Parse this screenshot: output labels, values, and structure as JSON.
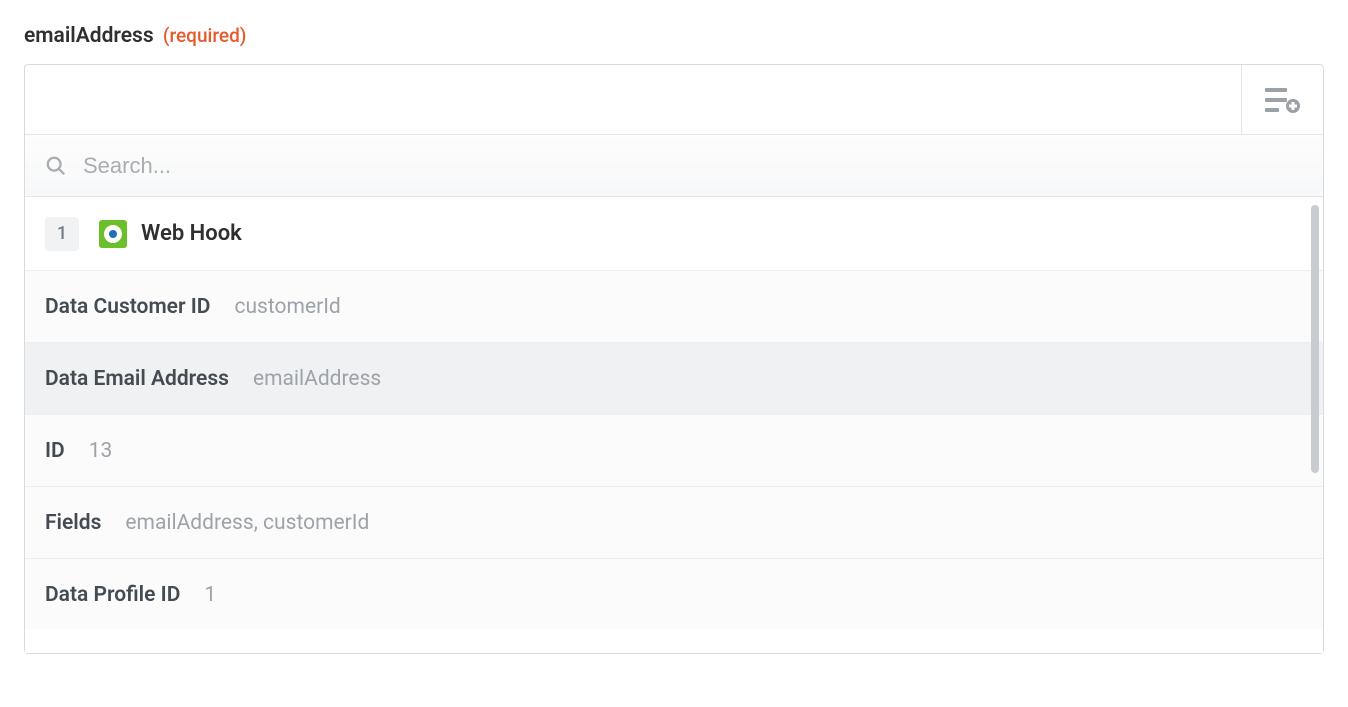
{
  "field": {
    "name": "emailAddress",
    "required_text": "(required)"
  },
  "value_input": {
    "value": ""
  },
  "search": {
    "placeholder": "Search..."
  },
  "source": {
    "step": "1",
    "app_name": "Web Hook"
  },
  "options": [
    {
      "label": "Data Customer ID",
      "value": "customerId",
      "hover": false
    },
    {
      "label": "Data Email Address",
      "value": "emailAddress",
      "hover": true
    },
    {
      "label": "ID",
      "value": "13",
      "hover": false
    },
    {
      "label": "Fields",
      "value": "emailAddress, customerId",
      "hover": false
    },
    {
      "label": "Data Profile ID",
      "value": "1",
      "hover": false
    }
  ]
}
